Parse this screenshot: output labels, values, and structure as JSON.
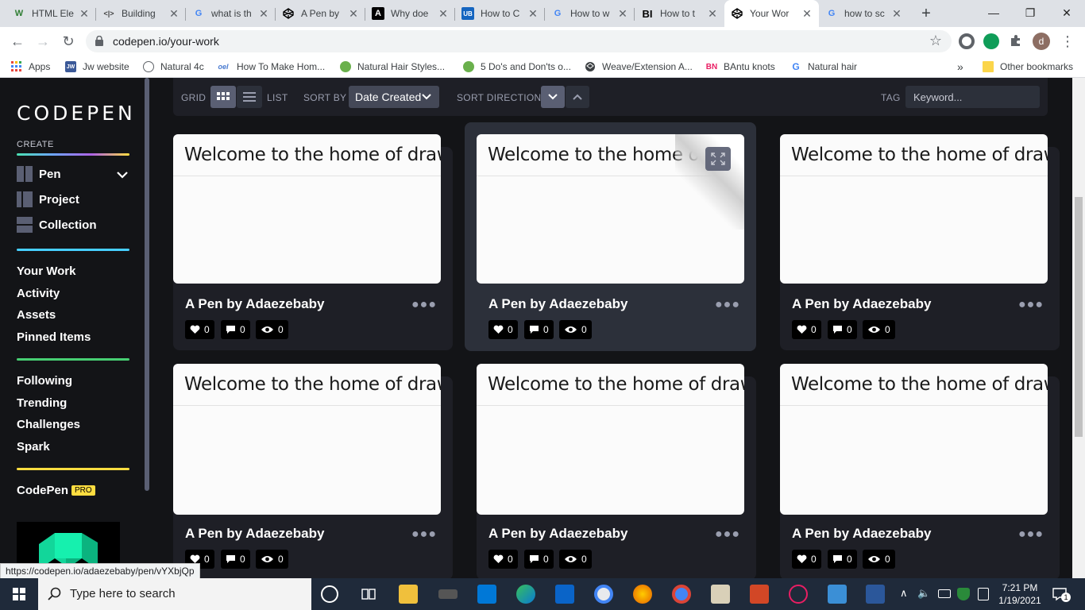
{
  "browser": {
    "tabs": [
      {
        "title": "HTML Ele",
        "favicon": "W",
        "fav_color": "#2e7d32"
      },
      {
        "title": "Building",
        "favicon": "<|>",
        "fav_color": "#444"
      },
      {
        "title": "what is th",
        "favicon": "G",
        "fav_color": "#4285f4"
      },
      {
        "title": "A Pen by",
        "favicon": "codepen-icon",
        "fav_color": "#000"
      },
      {
        "title": "Why doe",
        "favicon": "A",
        "fav_color": "#000"
      },
      {
        "title": "How to C",
        "favicon": "UB",
        "fav_color": "#1565c0"
      },
      {
        "title": "How to w",
        "favicon": "G",
        "fav_color": "#4285f4"
      },
      {
        "title": "How to t",
        "favicon": "BI",
        "fav_color": "#000"
      },
      {
        "title": "Your Wor",
        "favicon": "codepen-icon",
        "fav_color": "#000"
      },
      {
        "title": "how to sc",
        "favicon": "G",
        "fav_color": "#4285f4"
      }
    ],
    "active_tab": 8,
    "url": "codepen.io/your-work",
    "profile_initial": "d",
    "bookmarks": [
      {
        "label": "Apps",
        "icon": "apps-grid-icon"
      },
      {
        "label": "Jw website",
        "icon": "JW"
      },
      {
        "label": "Natural 4c",
        "icon": "globe-icon"
      },
      {
        "label": "How To Make Hom...",
        "icon": "oel"
      },
      {
        "label": "Natural Hair Styles...",
        "icon": "leaf-icon"
      },
      {
        "label": "5 Do's and Don'ts o...",
        "icon": "leaf-icon"
      },
      {
        "label": "Weave/Extension A...",
        "icon": "codepen-icon"
      },
      {
        "label": "BAntu knots",
        "icon": "BN"
      },
      {
        "label": "Natural hair",
        "icon": "G"
      }
    ],
    "more_bookmarks": "»",
    "other_bookmarks": "Other bookmarks",
    "status_url": "https://codepen.io/adaezebaby/pen/vYXbjQp"
  },
  "sidebar": {
    "logo": "CODEPEN",
    "create_label": "CREATE",
    "create_items": [
      "Pen",
      "Project",
      "Collection"
    ],
    "nav_group1": [
      "Your Work",
      "Activity",
      "Assets",
      "Pinned Items"
    ],
    "nav_group2": [
      "Following",
      "Trending",
      "Challenges",
      "Spark"
    ],
    "codepen_label": "CodePen",
    "pro_badge": "PRO"
  },
  "filters": {
    "grid_label": "GRID",
    "list_label": "LIST",
    "sort_by_label": "SORT BY",
    "sort_value": "Date Created",
    "sort_direction_label": "SORT DIRECTION",
    "tag_label": "TAG",
    "tag_placeholder": "Keyword..."
  },
  "pens": [
    {
      "preview_title": "Welcome to the home of drawings",
      "title": "A Pen by Adaezebaby",
      "likes": "0",
      "comments": "0",
      "views": "0"
    },
    {
      "preview_title": "Welcome to the home of drawings",
      "title": "A Pen by Adaezebaby",
      "likes": "0",
      "comments": "0",
      "views": "0"
    },
    {
      "preview_title": "Welcome to the home of drawings",
      "title": "A Pen by Adaezebaby",
      "likes": "0",
      "comments": "0",
      "views": "0"
    },
    {
      "preview_title": "Welcome to the home of drawings",
      "title": "A Pen by Adaezebaby",
      "likes": "0",
      "comments": "0",
      "views": "0"
    },
    {
      "preview_title": "Welcome to the home of drawings",
      "title": "A Pen by Adaezebaby",
      "likes": "0",
      "comments": "0",
      "views": "0"
    },
    {
      "preview_title": "Welcome to the home of drawings",
      "title": "A Pen by Adaezebaby",
      "likes": "0",
      "comments": "0",
      "views": "0"
    }
  ],
  "taskbar": {
    "search_placeholder": "Type here to search",
    "time": "7:21 PM",
    "date": "1/19/2021",
    "notifications": "1"
  },
  "colors": {
    "codepen_bg": "#131417",
    "card_bg": "#1e1f26",
    "pro_yellow": "#ffdd40"
  }
}
